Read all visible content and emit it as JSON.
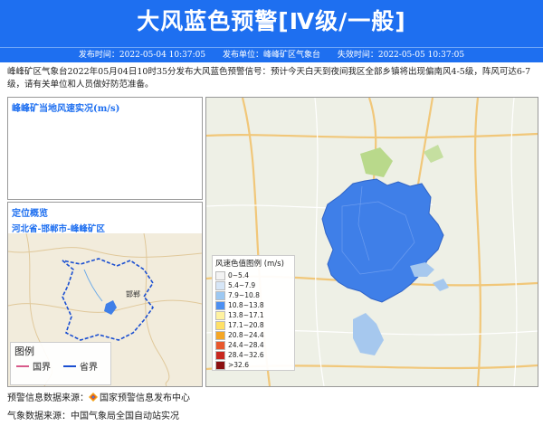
{
  "header": {
    "title": "大风蓝色预警[Ⅳ级/一般]",
    "issue_time": "发布时间：2022-05-04 10:37:05",
    "issuer": "发布单位：峰峰矿区气象台",
    "expire_time": "失效时间：2022-05-05 10:37:05"
  },
  "description": "峰峰矿区气象台2022年05月04日10时35分发布大风蓝色预警信号：预计今天白天到夜间我区全部乡镇将出现偏南风4-5级，阵风可达6-7级，请有关单位和人员做好防范准备。",
  "wind_panel": {
    "title": "峰峰矿当地风速实况(m/s)"
  },
  "location_panel": {
    "title": "定位概览",
    "path": "河北省-邯郸市-峰峰矿区",
    "city_label": "邯郸",
    "legend_title": "图例",
    "legend_items": [
      {
        "label": "国界",
        "color": "#d85a8a"
      },
      {
        "label": "省界",
        "color": "#1b4fd1"
      }
    ]
  },
  "wind_legend": {
    "title": "风速色值图例 (m/s)",
    "items": [
      {
        "label": "0~5.4",
        "color": "#f3f3f3"
      },
      {
        "label": "5.4~7.9",
        "color": "#d6e6f7"
      },
      {
        "label": "7.9~10.8",
        "color": "#9cc8f2"
      },
      {
        "label": "10.8~13.8",
        "color": "#4d8ff0"
      },
      {
        "label": "13.8~17.1",
        "color": "#fff2a0"
      },
      {
        "label": "17.1~20.8",
        "color": "#ffe066"
      },
      {
        "label": "20.8~24.4",
        "color": "#f5a623"
      },
      {
        "label": "24.4~28.4",
        "color": "#e8582c"
      },
      {
        "label": "28.4~32.6",
        "color": "#c8281e"
      },
      {
        "label": ">32.6",
        "color": "#8c1010"
      }
    ]
  },
  "footer": {
    "warning_source": "预警信息数据来源：",
    "warning_source_org": "国家预警信息发布中心",
    "weather_source": "气象数据来源：中国气象局全国自动站实况"
  },
  "colors": {
    "banner": "#1e6ff0",
    "warning_area": "#3f7fe8"
  }
}
